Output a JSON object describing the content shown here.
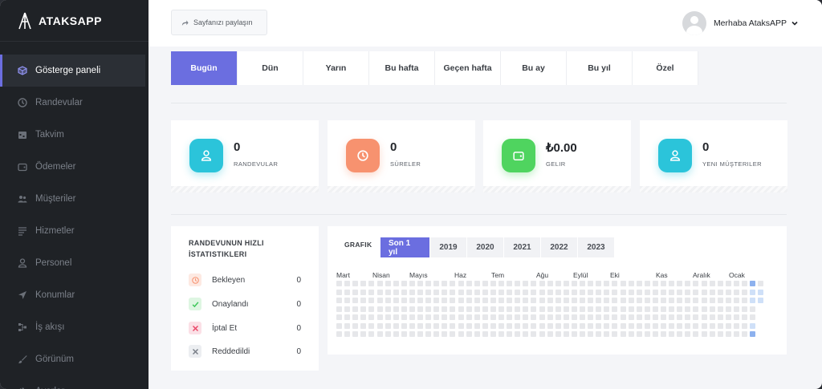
{
  "brand": {
    "name": "ATAKSAPP"
  },
  "sidebar": {
    "items": [
      {
        "label": "Gösterge paneli",
        "icon": "cube-icon",
        "active": true
      },
      {
        "label": "Randevular",
        "icon": "clock-icon"
      },
      {
        "label": "Takvim",
        "icon": "calendar-icon"
      },
      {
        "label": "Ödemeler",
        "icon": "wallet-icon"
      },
      {
        "label": "Müşteriler",
        "icon": "users-icon"
      },
      {
        "label": "Hizmetler",
        "icon": "list-icon"
      },
      {
        "label": "Personel",
        "icon": "user-icon"
      },
      {
        "label": "Konumlar",
        "icon": "location-arrow-icon"
      },
      {
        "label": "İş akışı",
        "icon": "workflow-icon"
      },
      {
        "label": "Görünüm",
        "icon": "brush-icon"
      },
      {
        "label": "Ayarlar",
        "icon": "gear-icon"
      }
    ]
  },
  "header": {
    "share_label": "Sayfanızı paylaşın",
    "greeting": "Merhaba AtaksAPP"
  },
  "period_tabs": [
    "Bugün",
    "Dün",
    "Yarın",
    "Bu hafta",
    "Geçen hafta",
    "Bu ay",
    "Bu yıl",
    "Özel"
  ],
  "active_period": "Bugün",
  "cards": [
    {
      "value": "0",
      "label": "RANDEVULAR",
      "icon": "user-icon",
      "color": "#2bc4da"
    },
    {
      "value": "0",
      "label": "SÜRELER",
      "icon": "clock-icon",
      "color": "#f7926f"
    },
    {
      "value": "₺0.00",
      "label": "GELIR",
      "icon": "wallet-icon",
      "color": "#4fd45f"
    },
    {
      "value": "0",
      "label": "YENI MÜŞTERILER",
      "icon": "user-icon",
      "color": "#2bc4da"
    }
  ],
  "quick_stats": {
    "title": "RANDEVUNUN HIZLI İSTATISTIKLERI",
    "items": [
      {
        "label": "Bekleyen",
        "value": "0",
        "icon": "clock-icon",
        "color": "#f7926f",
        "bg": "#fde9e2"
      },
      {
        "label": "Onaylandı",
        "value": "0",
        "icon": "check-icon",
        "color": "#3fc75a",
        "bg": "#def6e2"
      },
      {
        "label": "İptal Et",
        "value": "0",
        "icon": "x-icon",
        "color": "#ea4a6a",
        "bg": "#fbe0e6"
      },
      {
        "label": "Reddedildi",
        "value": "0",
        "icon": "x-icon",
        "color": "#7b8089",
        "bg": "#eceef1"
      }
    ]
  },
  "graph": {
    "title": "GRAFIK",
    "year_tabs": [
      "Son 1 yıl",
      "2019",
      "2020",
      "2021",
      "2022",
      "2023"
    ],
    "active_year": "Son 1 yıl",
    "months": [
      "Mart",
      "Nisan",
      "Mayıs",
      "Haz",
      "Tem",
      "Ağu",
      "Eylül",
      "Eki",
      "Kas",
      "Aralık",
      "Ocak"
    ],
    "colors": {
      "empty": "#e6e7ea",
      "low": "#cfe0f8",
      "high": "#8db1ee"
    }
  }
}
